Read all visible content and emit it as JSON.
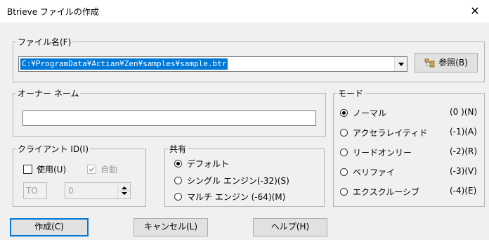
{
  "window": {
    "title": "Btrieve ファイルの作成",
    "close_glyph": "✕"
  },
  "file_name": {
    "legend": "ファイル名(F)",
    "value": "C:¥ProgramData¥Actian¥Zen¥samples¥sample.btr",
    "browse_label": "参照(B)",
    "browse_icon": "folder-tree-icon"
  },
  "owner_name": {
    "legend": "オーナー ネーム",
    "value": ""
  },
  "client_id": {
    "legend": "クライアント ID(I)",
    "use_label": "使用(U)",
    "auto_label": "自動",
    "prefix_value": "TO",
    "number_value": "0"
  },
  "share": {
    "legend": "共有",
    "options": [
      {
        "label": "デフォルト",
        "selected": true
      },
      {
        "label": "シングル エンジン(-32)(S)",
        "selected": false
      },
      {
        "label": "マルチ エンジン (-64)(M)",
        "selected": false
      }
    ]
  },
  "mode": {
    "legend": "モード",
    "options": [
      {
        "label": "ノーマル",
        "code": "(0 )(N)",
        "selected": true
      },
      {
        "label": "アクセラレイティド",
        "code": "(-1)(A)",
        "selected": false
      },
      {
        "label": "リードオンリー",
        "code": "(-2)(R)",
        "selected": false
      },
      {
        "label": "ベリファイ",
        "code": "(-3)(V)",
        "selected": false
      },
      {
        "label": "エクスクルーシブ",
        "code": "(-4)(E)",
        "selected": false
      }
    ]
  },
  "buttons": {
    "create": "作成(C)",
    "cancel": "キャンセル(L)",
    "help": "ヘルプ(H)"
  }
}
